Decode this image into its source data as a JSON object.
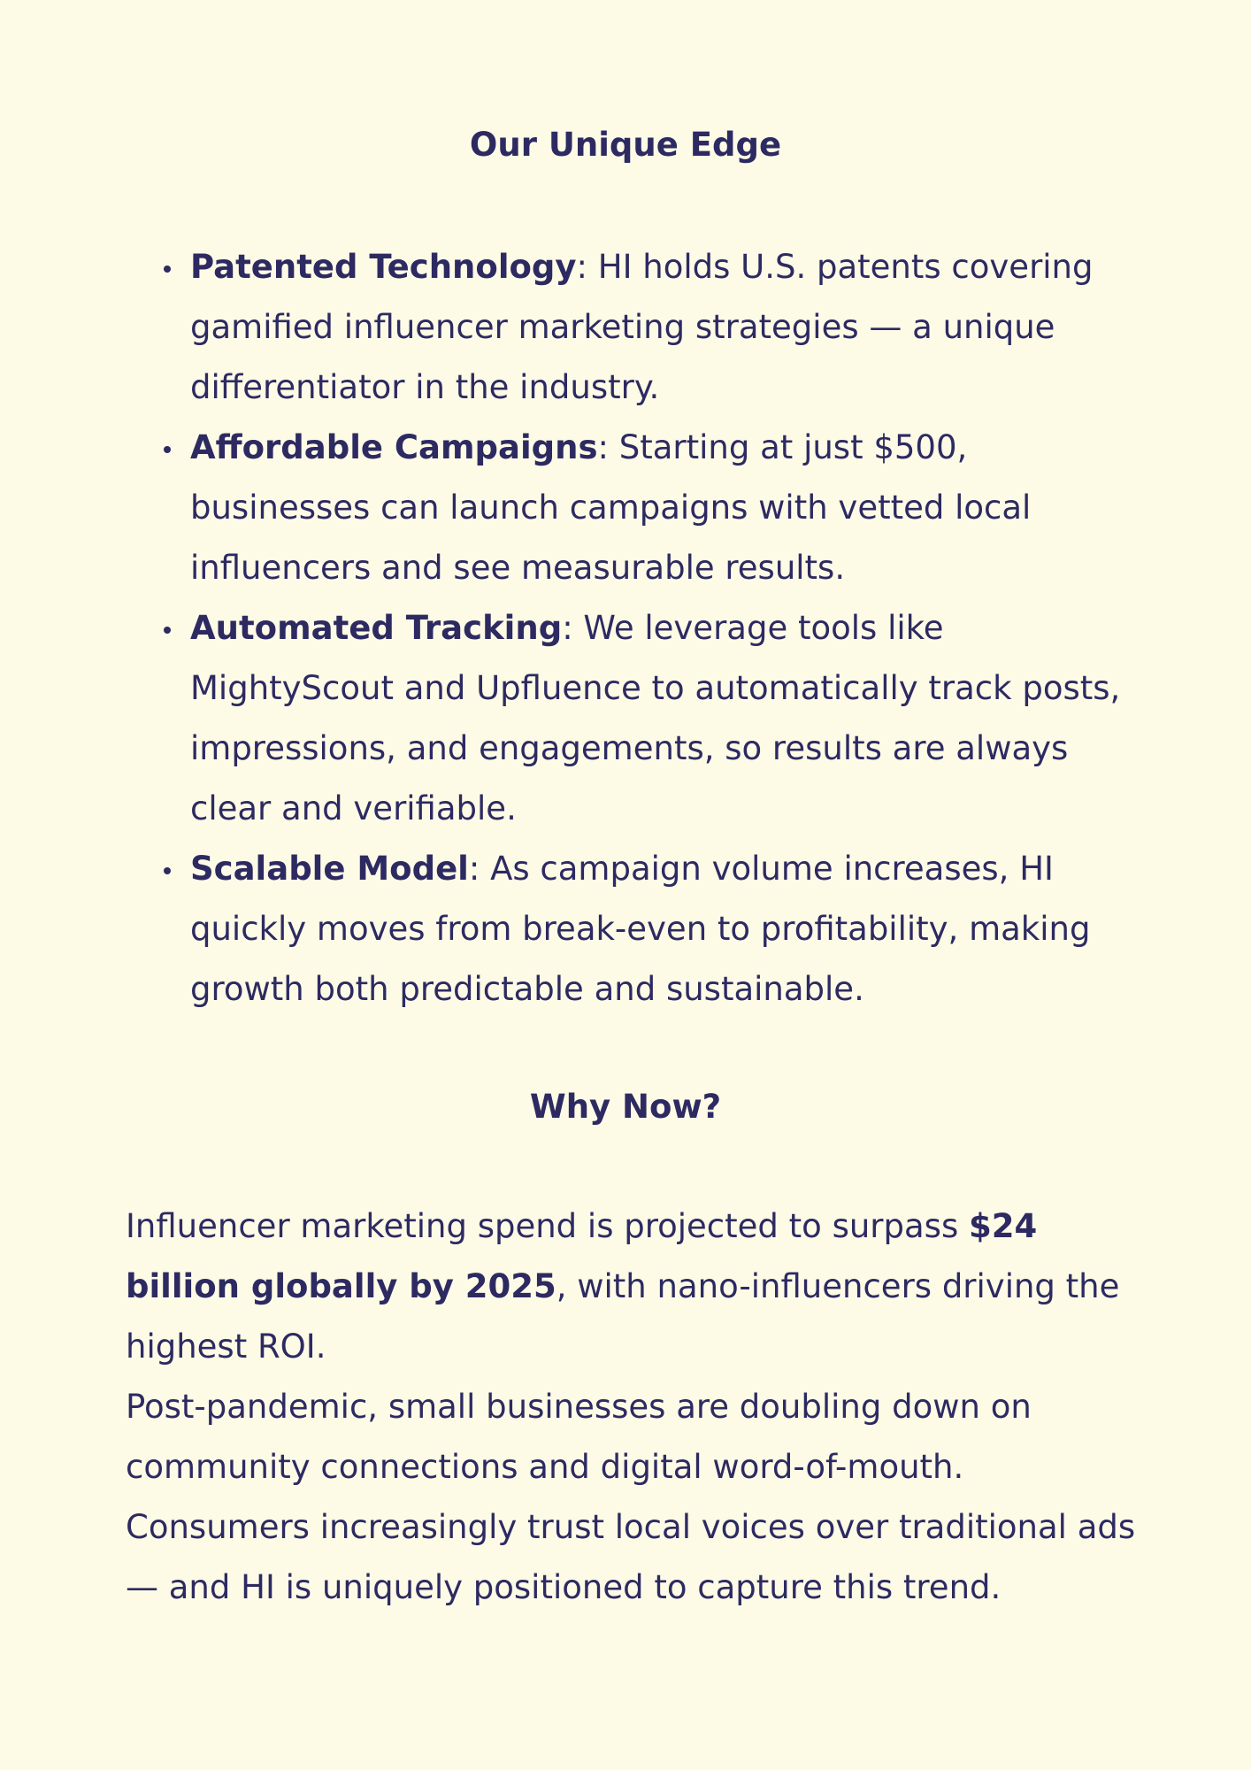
{
  "edge": {
    "title": "Our Unique Edge",
    "items": [
      {
        "term": "Patented Technology",
        "text": ": HI holds U.S. patents covering gamified influencer marketing strategies — a unique differentiator in the industry."
      },
      {
        "term": "Affordable Campaigns",
        "text": ": Starting at just $500, businesses can launch campaigns with vetted local influencers and see measurable results."
      },
      {
        "term": "Automated Tracking",
        "text": ": We leverage tools like MightyScout and Upfluence to automatically track posts, impressions, and engagements, so results are always clear and verifiable."
      },
      {
        "term": "Scalable Model",
        "text": ": As campaign volume increases, HI quickly moves from break-even to profitability, making growth both predictable and sustainable."
      }
    ]
  },
  "why_now": {
    "title": "Why Now?",
    "p1_before": "Influencer marketing spend is projected to surpass ",
    "p1_strong": "$24 billion globally by 2025",
    "p1_after": ", with nano-influencers driving the highest ROI.",
    "p2": "Post-pandemic, small businesses are doubling down on community connections and digital word-of-mouth.",
    "p3": "Consumers increasingly trust local voices over traditional ads — and HI is uniquely positioned to capture this trend."
  }
}
